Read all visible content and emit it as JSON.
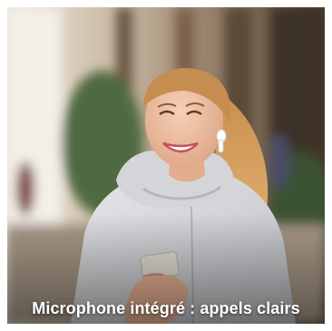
{
  "caption": {
    "text": "Microphone intégré : appels clairs"
  },
  "scene": {
    "subject": "woman-with-wireless-earbud",
    "colors": {
      "coat": "#d9dadc",
      "hair": "#d9a766",
      "skin": "#f0c3a3",
      "background_light": "#e9dcc7",
      "background_dark": "#5b4a3a",
      "foliage": "#3f5a37"
    }
  }
}
